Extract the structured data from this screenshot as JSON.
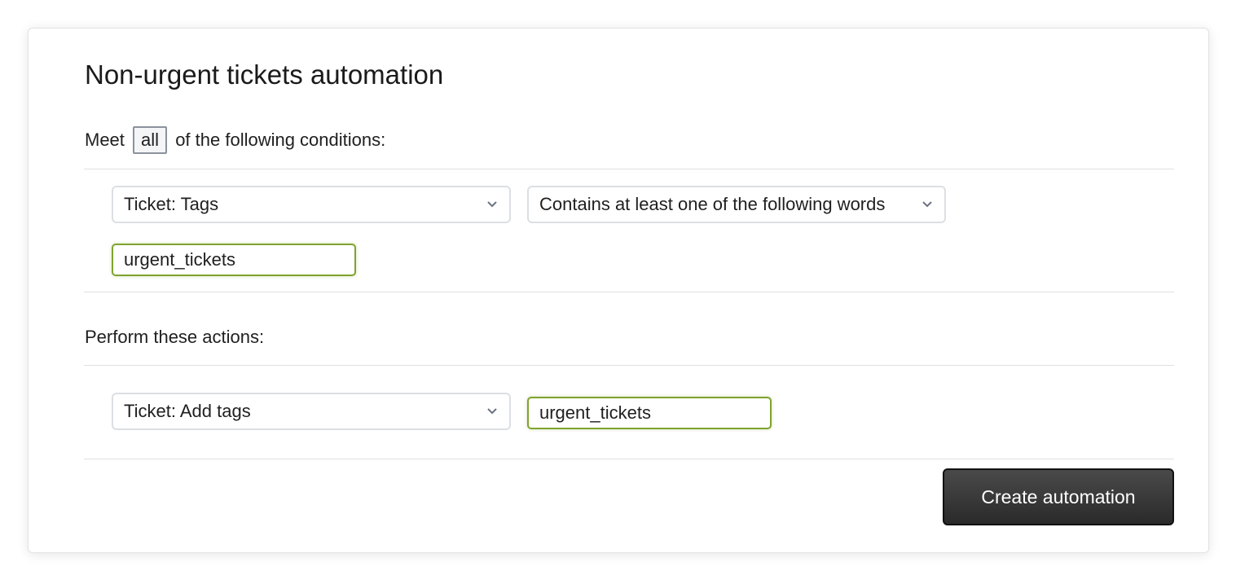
{
  "title": "Non-urgent tickets automation",
  "conditions": {
    "prefix": "Meet",
    "match_mode": "all",
    "suffix": "of the following conditions:",
    "field": "Ticket: Tags",
    "operator": "Contains at least one of the following words",
    "value": "urgent_tickets"
  },
  "actions": {
    "heading": "Perform these actions:",
    "action": "Ticket: Add tags",
    "value": "urgent_tickets"
  },
  "submit_label": "Create automation",
  "colors": {
    "accent_border": "#7fa32f",
    "button": "#333333"
  }
}
